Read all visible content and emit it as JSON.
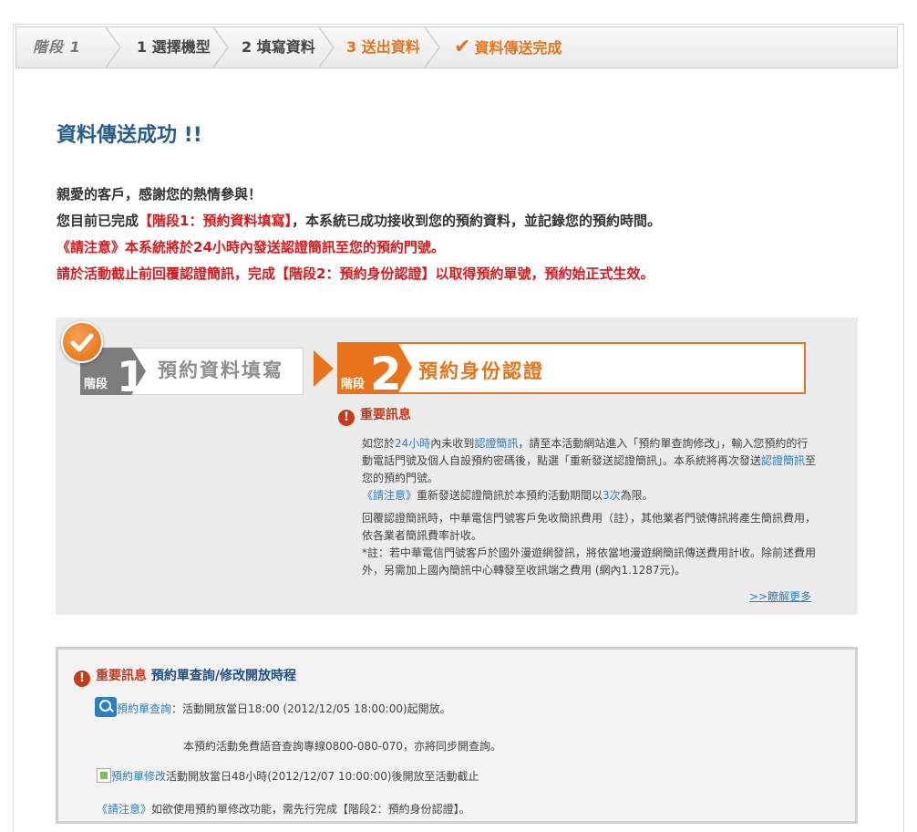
{
  "stepbar": {
    "stage_label": "階段 1",
    "steps": [
      "1 選擇機型",
      "2 填寫資料",
      "3 送出資料",
      "資料傳送完成"
    ]
  },
  "success_title": "資料傳送成功 !!",
  "intro": {
    "line1": "親愛的客戶，感謝您的熱情參與！",
    "line2a": "您目前已完成",
    "line2b": "【階段1：預約資料填寫】",
    "line2c": "，本系統已成功接收到您的預約資料，並記錄您的預約時間。",
    "line3": "《請注意》本系統將於24小時內發送認證簡訊至您的預約門號。",
    "line4": "請於活動截止前回覆認證簡訊，完成【階段2：預約身份認證】以取得預約單號，預約始正式生效。"
  },
  "panel": {
    "stage1_tag": "階段",
    "stage1_num": "1",
    "stage1_label": "預約資料填寫",
    "stage2_tag": "階段",
    "stage2_num": "2",
    "stage2_label": "預約身份認證",
    "important_title": "重要訊息",
    "p1_a": "如您於",
    "p1_b": "24小時",
    "p1_c": "內未收到",
    "p1_d": "認證簡訊",
    "p1_e": "，請至本活動網站進入「預約單查詢修改」，輸入您預約的行動電話門號及個人自設預約密碼後，點選「重新發送認證簡訊」。本系統將再次發送",
    "p1_f": "認證簡訊",
    "p1_g": "至您的預約門號。",
    "p2_a": "《請注意》",
    "p2_b": "重新發送認證簡訊於本預約活動期間以",
    "p2_c": "3次",
    "p2_d": "為限。",
    "p3": "回覆認證簡訊時，中華電信門號客戶免收簡訊費用（註），其他業者門號傳訊將產生簡訊費用，依各業者簡訊費率計收。",
    "p4": "*註：若中華電信門號客戶於國外漫遊網發訊，將依當地漫遊網簡訊傳送費用計收。除前述費用外，另需加上國內簡訊中心轉發至收訊端之費用 (網內1.1287元)。",
    "more_link": ">>瞭解更多"
  },
  "bottom": {
    "head_red": "重要訊息",
    "head_blue": "預約單查詢/修改開放時程",
    "query_link": "預約單查詢",
    "query_text": "：活動開放當日18:00 (2012/12/05 18:00:00)起開放。",
    "hotline_text": "本預約活動免費語音查詢專線0800-080-070，亦將同步開查詢。",
    "modify_link": "預約單修改",
    "modify_text": "活動開放當日48小時(2012/12/07 10:00:00)後開放至活動截止",
    "note_blue": "《請注意》",
    "note_text": "如欲使用預約單修改功能，需先行完成【階段2：預約身份認證】。"
  }
}
